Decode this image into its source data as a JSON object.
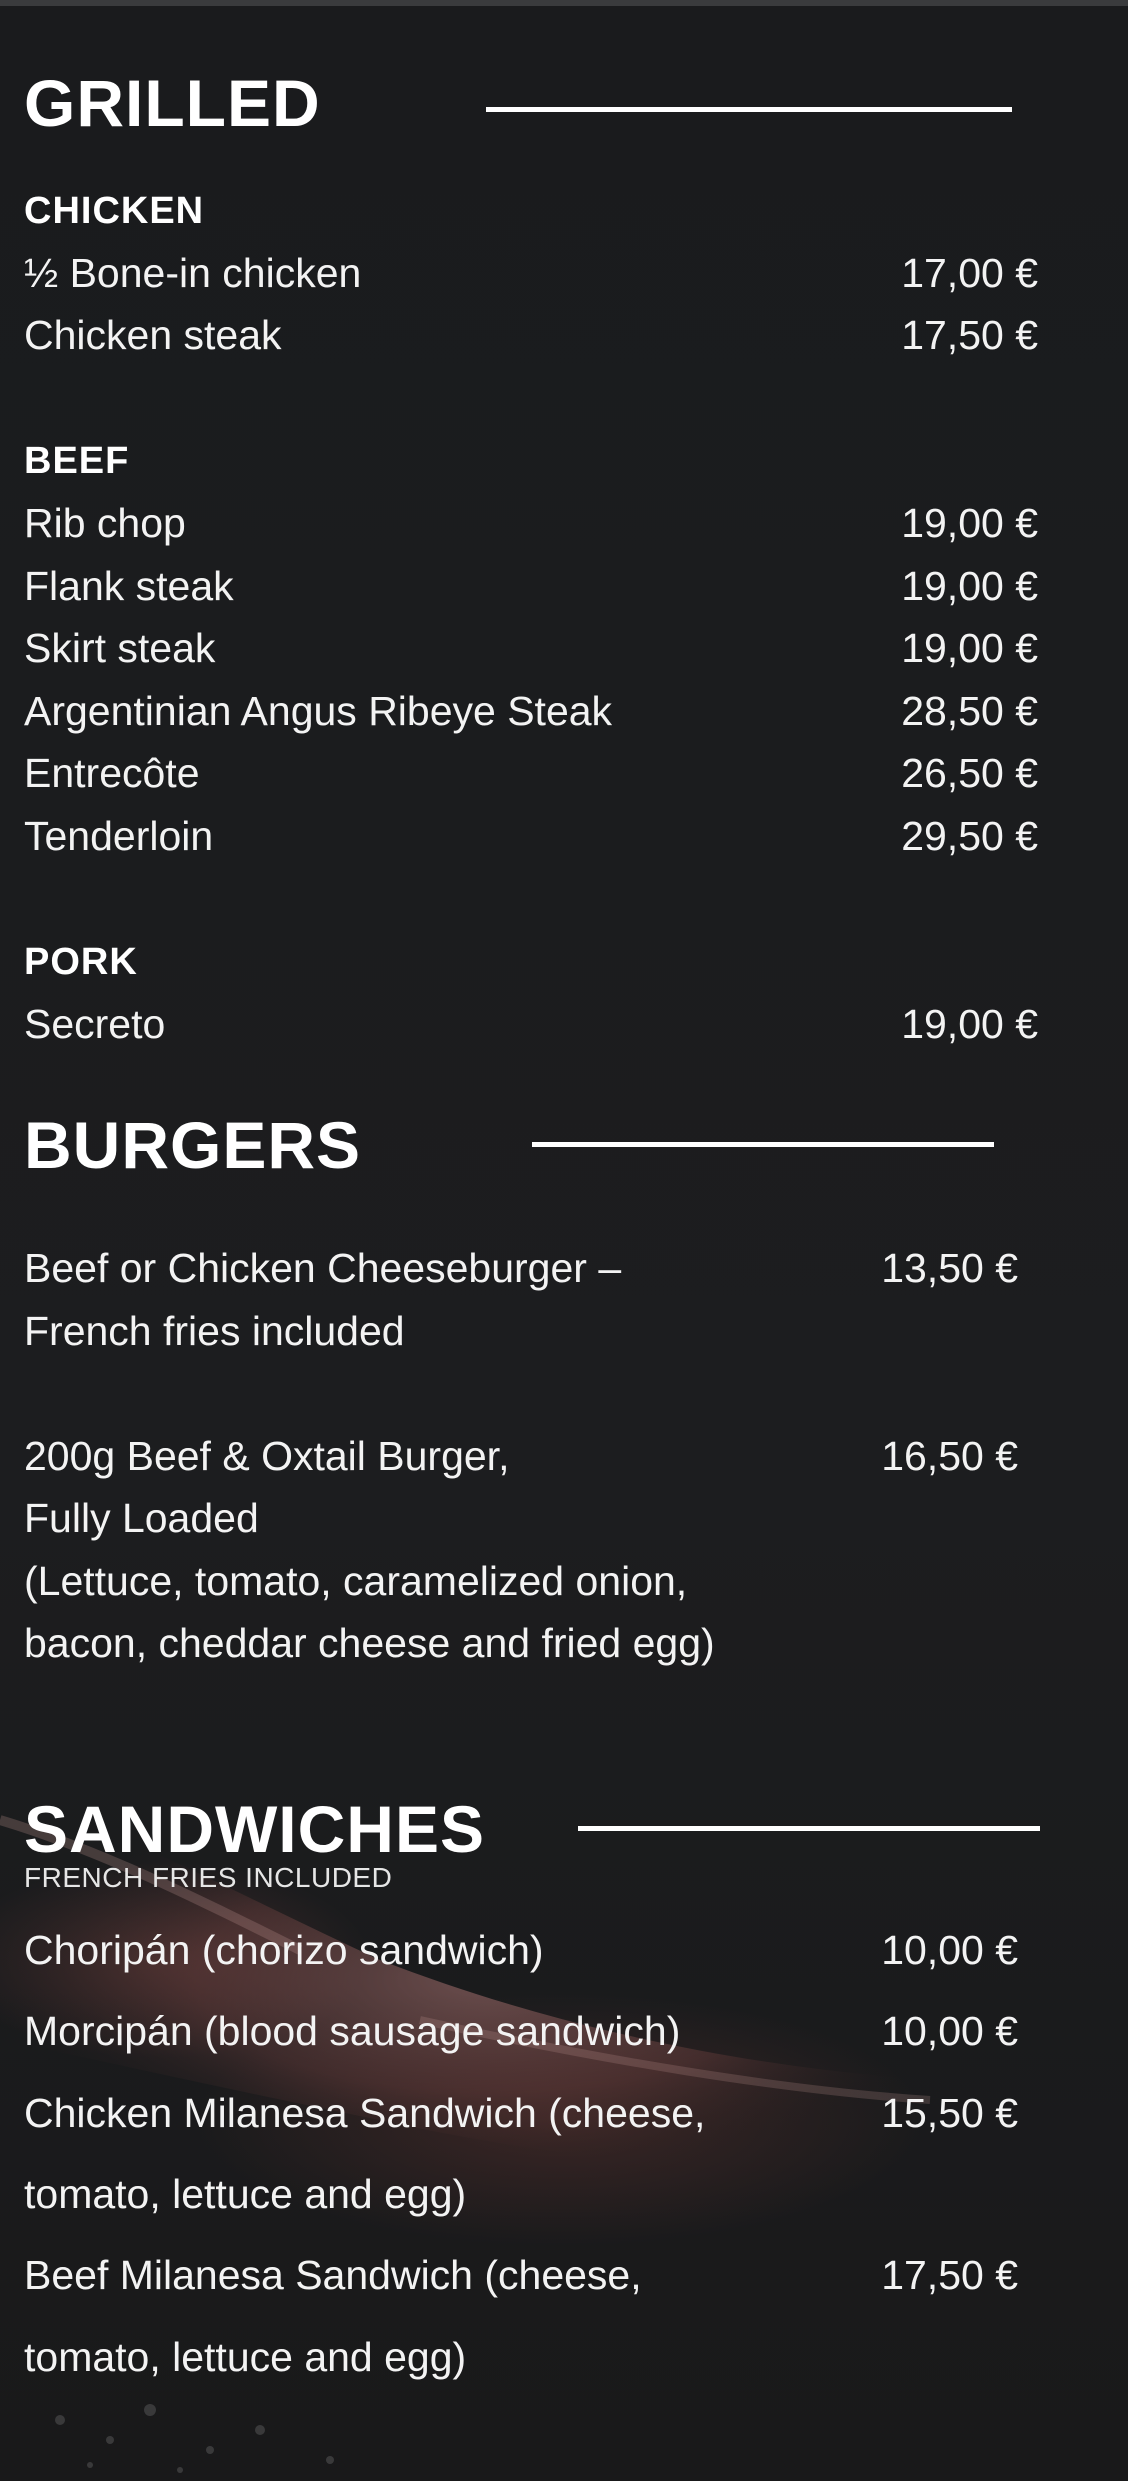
{
  "sections": {
    "grilled": {
      "title": "GRILLED",
      "categories": {
        "chicken": {
          "title": "CHICKEN",
          "items": [
            {
              "name": "½ Bone-in chicken",
              "price": "17,00 €"
            },
            {
              "name": "Chicken steak",
              "price": "17,50 €"
            }
          ]
        },
        "beef": {
          "title": "BEEF",
          "items": [
            {
              "name": "Rib chop",
              "price": "19,00 €"
            },
            {
              "name": "Flank steak",
              "price": "19,00 €"
            },
            {
              "name": "Skirt steak",
              "price": "19,00 €"
            },
            {
              "name": "Argentinian Angus Ribeye Steak",
              "price": "28,50 €"
            },
            {
              "name": "Entrecôte",
              "price": "26,50 €"
            },
            {
              "name": "Tenderloin",
              "price": "29,50 €"
            }
          ]
        },
        "pork": {
          "title": "PORK",
          "items": [
            {
              "name": "Secreto",
              "price": "19,00 €"
            }
          ]
        }
      }
    },
    "burgers": {
      "title": "BURGERS",
      "items": [
        {
          "lines": [
            "Beef or Chicken Cheeseburger –",
            "French fries included"
          ],
          "price": "13,50 €"
        },
        {
          "lines": [
            "200g Beef & Oxtail Burger,",
            "Fully Loaded",
            "(Lettuce, tomato, caramelized onion,",
            "bacon, cheddar cheese and fried egg)"
          ],
          "price": "16,50 €"
        }
      ]
    },
    "sandwiches": {
      "title": "SANDWICHES",
      "subtitle": "FRENCH FRIES INCLUDED",
      "items": [
        {
          "lines": [
            "Choripán (chorizo sandwich)"
          ],
          "price": "10,00 €"
        },
        {
          "lines": [
            "Morcipán (blood sausage sandwich)"
          ],
          "price": "10,00 €"
        },
        {
          "lines": [
            "Chicken Milanesa Sandwich (cheese,",
            "tomato, lettuce and egg)"
          ],
          "price": "15,50 €"
        },
        {
          "lines": [
            "Beef Milanesa Sandwich (cheese,",
            "tomato, lettuce and egg)"
          ],
          "price": "17,50 €"
        }
      ]
    }
  }
}
